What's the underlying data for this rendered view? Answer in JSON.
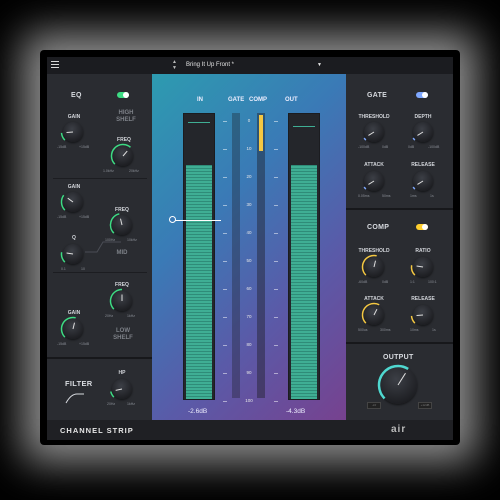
{
  "topbar": {
    "preset_name": "Bring It Up Front *",
    "arrow_up": "▲",
    "arrow_down": "▼",
    "dropdown": "▼"
  },
  "colors": {
    "eq_toggle": "#3ddc84",
    "gate_toggle": "#7fa8ff",
    "comp_toggle": "#ffcf2e",
    "knob_green": "#3ddc84",
    "knob_yellow": "#f5c842",
    "knob_teal": "#4fd8d0"
  },
  "eq": {
    "title": "EQ",
    "high_shelf": {
      "name": "HIGH\nSHELF",
      "gain_label": "GAIN",
      "gain_min": "-15dB",
      "gain_max": "+15dB",
      "freq_label": "FREQ",
      "freq_min": "1.0kHz",
      "freq_max": "20kHz"
    },
    "mid": {
      "name": "MID",
      "gain_label": "GAIN",
      "gain_min": "-15dB",
      "gain_max": "+15dB",
      "freq_label": "FREQ",
      "freq_min": "100Hz",
      "freq_max": "10kHz",
      "q_label": "Q",
      "q_min": "0.1",
      "q_max": "10"
    },
    "low_shelf": {
      "name": "LOW\nSHELF",
      "gain_label": "GAIN",
      "gain_min": "-15dB",
      "gain_max": "+15dB",
      "freq_label": "FREQ",
      "freq_min": "20Hz",
      "freq_max": "1kHz"
    }
  },
  "filter": {
    "title": "FILTER",
    "hp_label": "HP",
    "hp_min": "20Hz",
    "hp_max": "1kHz"
  },
  "meters": {
    "in_label": "IN",
    "gate_label": "GATE",
    "comp_label": "COMP",
    "out_label": "OUT",
    "scale": [
      "0",
      "10",
      "20",
      "30",
      "40",
      "50",
      "60",
      "70",
      "80",
      "90",
      "100"
    ],
    "in_db": "-2.6dB",
    "out_db": "-4.3dB",
    "in_level": 0.82,
    "out_level": 0.82
  },
  "gate": {
    "title": "GATE",
    "threshold_label": "THRESHOLD",
    "threshold_min": "-100dB",
    "threshold_max": "0dB",
    "depth_label": "DEPTH",
    "depth_min": "0dB",
    "depth_max": "-100dB",
    "attack_label": "ATTACK",
    "attack_min": "0.05ms",
    "attack_max": "50ms",
    "release_label": "RELEASE",
    "release_min": "1ms",
    "release_max": "1s"
  },
  "comp": {
    "title": "COMP",
    "threshold_label": "THRESHOLD",
    "threshold_min": "-60dB",
    "threshold_max": "0dB",
    "ratio_label": "RATIO",
    "ratio_min": "1:1",
    "ratio_max": "100:1",
    "attack_label": "ATTACK",
    "attack_min": "500us",
    "attack_max": "300ms",
    "release_label": "RELEASE",
    "release_min": "10ms",
    "release_max": "1s"
  },
  "output": {
    "title": "OUTPUT",
    "min": "-inf",
    "max": "+12dB"
  },
  "footer": {
    "brand": "CHANNEL STRIP",
    "logo": "air"
  }
}
